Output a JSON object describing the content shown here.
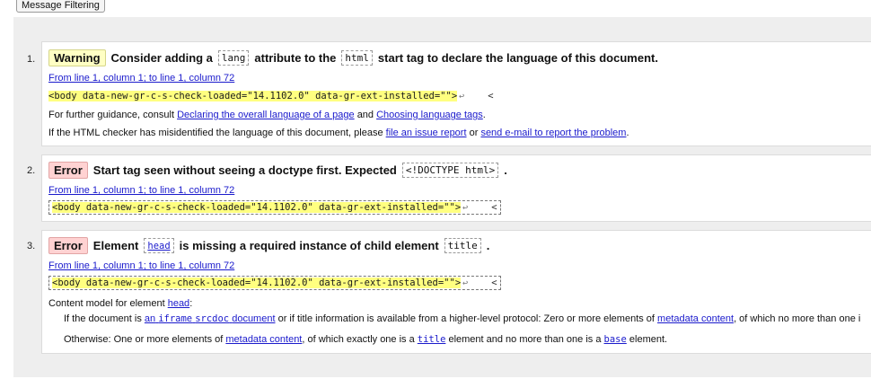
{
  "filter_button": "Message Filtering",
  "messages": [
    {
      "num": "1.",
      "type": "Warning",
      "msg_pre": "Consider adding a",
      "code1": "lang",
      "msg_mid": "attribute to the",
      "code2": "html",
      "msg_post": "start tag to declare the language of this document.",
      "location": "From line 1, column 1; to line 1, column 72",
      "extract": "<body data-new-gr-c-s-check-loaded=\"14.1102.0\" data-gr-ext-installed=\"\">",
      "extract_return": "↩",
      "extract_tail": "<",
      "guidance": {
        "prefix": "For further guidance, consult",
        "link1": "Declaring the overall language of a page",
        "and": "and",
        "link2": "Choosing language tags",
        "end": "."
      },
      "misidentified": {
        "prefix": "If the HTML checker has misidentified the language of this document, please",
        "link1": "file an issue report",
        "or": "or",
        "link2": "send e-mail to report the problem",
        "end": "."
      }
    },
    {
      "num": "2.",
      "type": "Error",
      "msg_pre": "Start tag seen without seeing a doctype first. Expected",
      "code1": "<!DOCTYPE html>",
      "msg_post": ".",
      "location": "From line 1, column 1; to line 1, column 72",
      "extract": "<body data-new-gr-c-s-check-loaded=\"14.1102.0\" data-gr-ext-installed=\"\">",
      "extract_return": "↩",
      "extract_tail": "<"
    },
    {
      "num": "3.",
      "type": "Error",
      "msg_pre": "Element",
      "code1": "head",
      "msg_mid": "is missing a required instance of child element",
      "code2": "title",
      "msg_post": ".",
      "location": "From line 1, column 1; to line 1, column 72",
      "extract": "<body data-new-gr-c-s-check-loaded=\"14.1102.0\" data-gr-ext-installed=\"\">",
      "extract_return": "↩",
      "extract_tail": "<",
      "content_model": {
        "prefix": "Content model for element",
        "link": "head",
        "end": ":"
      },
      "srcdoc_line": {
        "prefix": "If the document is",
        "link_article": "an",
        "link_code": "iframe",
        "link_code2": "srcdoc",
        "link_rest": "document",
        "mid": "or if title information is available from a higher-level protocol: Zero or more elements of",
        "link2": "metadata content",
        "end": ", of which no more than one i"
      },
      "otherwise_line": {
        "prefix": "Otherwise: One or more elements of",
        "link1": "metadata content",
        "mid": ", of which exactly one is a",
        "link2": "title",
        "mid2": "element and no more than one is a",
        "link3": "base",
        "end": "element."
      }
    }
  ]
}
